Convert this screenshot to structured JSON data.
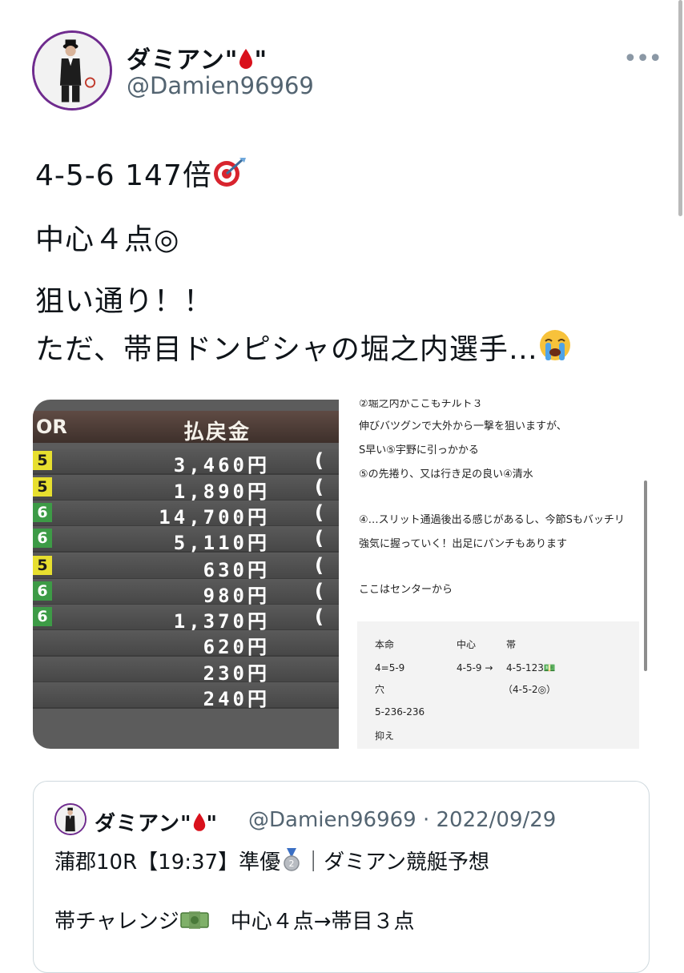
{
  "author": {
    "display_name": "ダミアン\"",
    "display_name_end": "\"",
    "handle": "@Damien96969"
  },
  "more_icon": "•••",
  "tweet": {
    "line1": "4-5-6  147倍",
    "line2": "中心４点◎",
    "line3": "狙い通り！！",
    "line4": "ただ、帯目ドンピシャの堀之内選手…"
  },
  "payout_image": {
    "col_label": "OR",
    "title": "払戻金",
    "rows": [
      {
        "badge": "5",
        "color": "yellow",
        "amount": "3,460円",
        "paren": "("
      },
      {
        "badge": "5",
        "color": "yellow",
        "amount": "1,890円",
        "paren": "("
      },
      {
        "badge": "6",
        "color": "green",
        "amount": "14,700円",
        "paren": "("
      },
      {
        "badge": "6",
        "color": "green",
        "amount": "5,110円",
        "paren": "("
      },
      {
        "badge": "5",
        "color": "yellow",
        "amount": "630円",
        "paren": "("
      },
      {
        "badge": "6",
        "color": "green",
        "amount": "980円",
        "paren": "("
      },
      {
        "badge": "6",
        "color": "green",
        "amount": "1,370円",
        "paren": "("
      },
      {
        "badge": "",
        "color": "none",
        "amount": "620円",
        "paren": ""
      },
      {
        "badge": "",
        "color": "none",
        "amount": "230円",
        "paren": ""
      },
      {
        "badge": "",
        "color": "none",
        "amount": "240円",
        "paren": ""
      }
    ]
  },
  "notes_image": {
    "lines": [
      "②堀之内がここもチルト３",
      "伸びバツグンで大外から一撃を狙いますが、",
      "S早い⑤宇野に引っかかる",
      "⑤の先捲り、又は行き足の良い④清水",
      "④…スリット通過後出る感じがあるし、今節Sもバッチリ",
      "強気に握っていく！出足にパンチもあります",
      "ここはセンターから"
    ],
    "box": {
      "honmei_label": "本命",
      "chushin_label": "中心",
      "obi_label": "帯",
      "honmei_value": "4=5-9",
      "chushin_value": "4-5-9 →",
      "obi_value": "4-5-123💵",
      "obi_value2": "（4-5-2◎）",
      "ana_label": "穴",
      "ana_value": "5-236-236",
      "osae_label": "抑え"
    }
  },
  "quote": {
    "display_name": "ダミアン\"",
    "display_name_end": "\"",
    "handle_date": "@Damien96969 · 2022/09/29",
    "line1": "蒲郡10R【19:37】準優",
    "line1_end": "｜ダミアン競艇予想",
    "line2": "帯チャレンジ",
    "line2_end": "　中心４点→帯目３点"
  }
}
